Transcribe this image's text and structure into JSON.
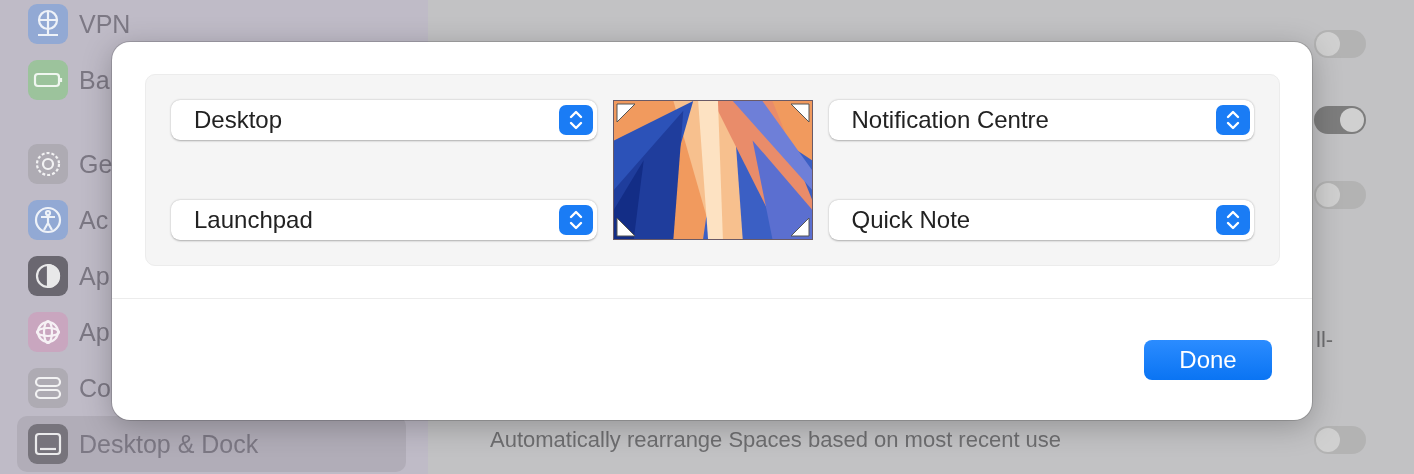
{
  "sidebar": {
    "groups": [
      {
        "items": [
          {
            "label": "VPN",
            "color": "#92a9d4",
            "selected": false
          },
          {
            "label": "Ba",
            "color": "#9cc39c",
            "selected": false
          }
        ]
      },
      {
        "items": [
          {
            "label": "Ge",
            "color": "#aeabb3",
            "selected": false
          },
          {
            "label": "Ac",
            "color": "#92a9d4",
            "selected": false
          },
          {
            "label": "Ap",
            "color": "#6a6770",
            "selected": false
          },
          {
            "label": "Ap",
            "color": "#c9a6bf",
            "selected": false
          },
          {
            "label": "Co",
            "color": "#aeabb3",
            "selected": false
          },
          {
            "label": "Desktop & Dock",
            "color": "#77747c",
            "selected": true
          }
        ]
      }
    ]
  },
  "settings": [
    {
      "kind": "toggle",
      "on": false
    },
    {
      "kind": "toggle",
      "on": true
    },
    {
      "kind": "toggle",
      "on": false
    },
    {
      "kind": "text",
      "label": "ll-"
    },
    {
      "kind": "toggle",
      "label": "Automatically rearrange Spaces based on most recent use",
      "on": false
    }
  ],
  "dialog": {
    "corners": [
      "Desktop",
      "Notification Centre",
      "Launchpad",
      "Quick Note"
    ],
    "preview": {
      "kind": "picture"
    },
    "done_button": "Done"
  }
}
